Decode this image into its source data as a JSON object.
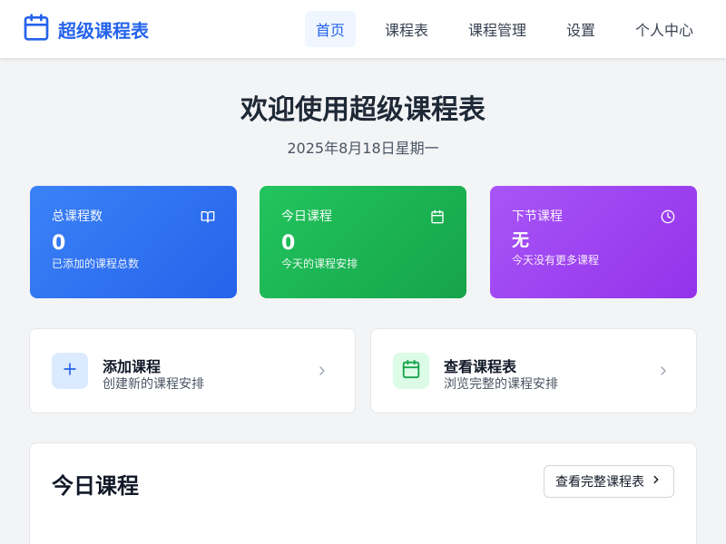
{
  "brand": {
    "name": "超级课程表",
    "icon": "calendar-icon"
  },
  "nav": {
    "items": [
      {
        "label": "首页",
        "active": true
      },
      {
        "label": "课程表",
        "active": false
      },
      {
        "label": "课程管理",
        "active": false
      },
      {
        "label": "设置",
        "active": false
      },
      {
        "label": "个人中心",
        "active": false
      }
    ]
  },
  "hero": {
    "title": "欢迎使用超级课程表",
    "date": "2025年8月18日星期一"
  },
  "stats": [
    {
      "label": "总课程数",
      "value": "0",
      "desc": "已添加的课程总数",
      "icon": "book-open-icon",
      "color": "#3b82f6"
    },
    {
      "label": "今日课程",
      "value": "0",
      "desc": "今天的课程安排",
      "icon": "calendar-icon",
      "color": "#22c55e"
    },
    {
      "label": "下节课程",
      "value": "无",
      "desc": "今天没有更多课程",
      "icon": "clock-icon",
      "color": "#a855f7"
    }
  ],
  "actions": [
    {
      "title": "添加课程",
      "desc": "创建新的课程安排",
      "icon": "plus-icon",
      "color": "#2563eb"
    },
    {
      "title": "查看课程表",
      "desc": "浏览完整的课程安排",
      "icon": "calendar-icon",
      "color": "#16a34a"
    }
  ],
  "today": {
    "title": "今日课程",
    "view_all_label": "查看完整课程表"
  }
}
